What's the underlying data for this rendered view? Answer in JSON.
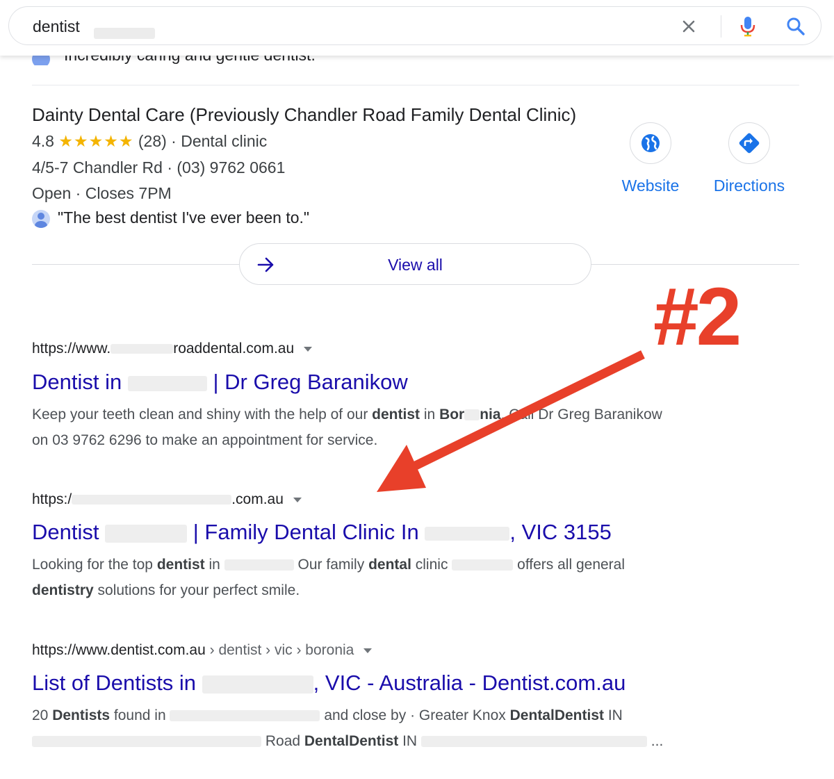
{
  "search": {
    "query": "dentist",
    "clear_icon": "close-icon",
    "mic_icon": "mic-icon",
    "search_icon": "search-icon"
  },
  "partial_review": "Incredibly caring and gentle dentist.",
  "local": {
    "name": "Dainty Dental Care (Previously Chandler Road Family Dental Clinic)",
    "rating": "4.8",
    "stars": "★★★★★",
    "review_count": "(28)",
    "category": "· Dental clinic",
    "address_phone": "4/5-7 Chandler Rd · (03) 9762 0661",
    "open": "Open",
    "closes": "· Closes 7PM",
    "review": "\"The best dentist I've ever been to.\"",
    "website_label": "Website",
    "directions_label": "Directions",
    "view_all_label": "View all"
  },
  "results": [
    {
      "url_pre": "https://www.",
      "url_post": "roaddental.com.au",
      "title_pre": "Dentist in",
      "title_post": "| Dr Greg Baranikow",
      "snippet_1": "Keep your teeth clean and shiny with the help of our",
      "snippet_b1": "dentist",
      "snippet_2": "in",
      "snippet_b2": "Bor",
      "snippet_b3": "nia",
      "snippet_3": ". Call Dr Greg Baranikow",
      "snippet_line2": "on 03 9762 6296 to make an appointment for service."
    },
    {
      "url_pre": "https:/",
      "url_post": ".com.au",
      "title_pre": "Dentist",
      "title_post": "| Family Dental Clinic In",
      "title_end": ", VIC 3155",
      "snippet_1": "Looking for the top",
      "snippet_b1": "dentist",
      "snippet_2": "in",
      "snippet_3": "Our family",
      "snippet_b2": "dental",
      "snippet_4": "clinic",
      "snippet_5": "offers all general",
      "snippet_b3": "dentistry",
      "snippet_6": "solutions for your perfect smile."
    },
    {
      "url": "https://www.dentist.com.au",
      "crumbs": " › dentist › vic › boronia",
      "title_pre": "List of Dentists in",
      "title_post": ", VIC - Australia - Dentist.com.au",
      "snippet_1": "20",
      "snippet_b1": "Dentists",
      "snippet_2": "found in",
      "snippet_3": "and close by · Greater Knox",
      "snippet_b2": "DentalDentist",
      "snippet_4": "IN",
      "snippet_5": "Road",
      "snippet_b3": "DentalDentist",
      "snippet_6": "IN",
      "snippet_7": "..."
    }
  ],
  "annotation": {
    "label": "#2",
    "color": "#e8402a"
  },
  "colors": {
    "link": "#1a0dab",
    "accent": "#1a73e8",
    "star": "#f4b400"
  }
}
